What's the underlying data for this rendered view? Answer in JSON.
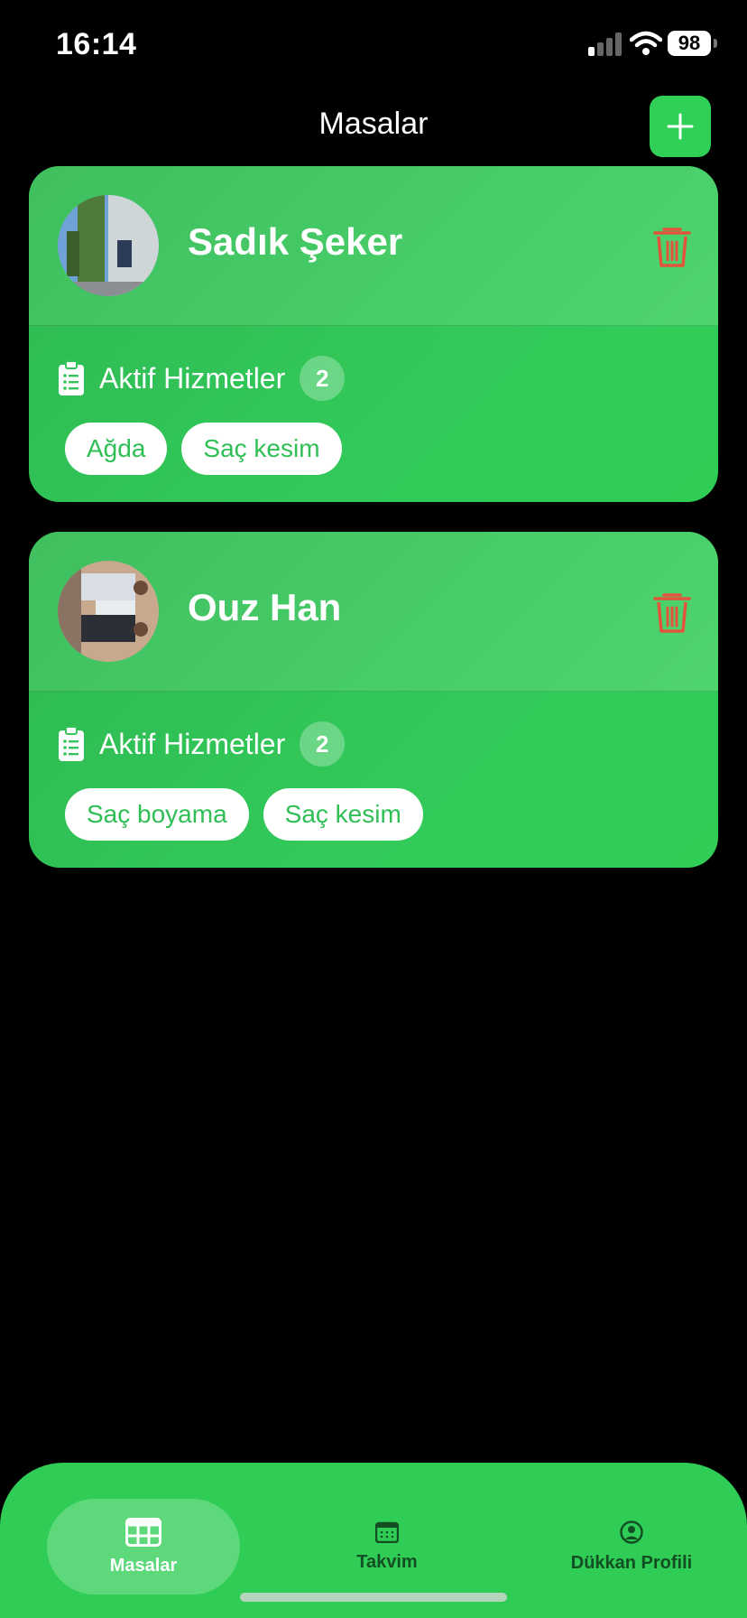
{
  "status_bar": {
    "time": "16:14",
    "battery": "98"
  },
  "header": {
    "title": "Masalar",
    "add_icon": "plus-icon"
  },
  "tables": [
    {
      "name": "Sadık Şeker",
      "services_label": "Aktif Hizmetler",
      "services_count": "2",
      "services": [
        "Ağda",
        "Saç kesim"
      ]
    },
    {
      "name": "Ouz Han",
      "services_label": "Aktif Hizmetler",
      "services_count": "2",
      "services": [
        "Saç boyama",
        "Saç kesim"
      ]
    }
  ],
  "tab_bar": {
    "tabs": [
      {
        "label": "Masalar",
        "icon": "table-icon",
        "active": true
      },
      {
        "label": "Takvim",
        "icon": "calendar-icon",
        "active": false
      },
      {
        "label": "Dükkan Profili",
        "icon": "person-circle-icon",
        "active": false
      }
    ]
  },
  "colors": {
    "accent": "#30cd56",
    "delete": "#e2543b",
    "background": "#000000"
  }
}
